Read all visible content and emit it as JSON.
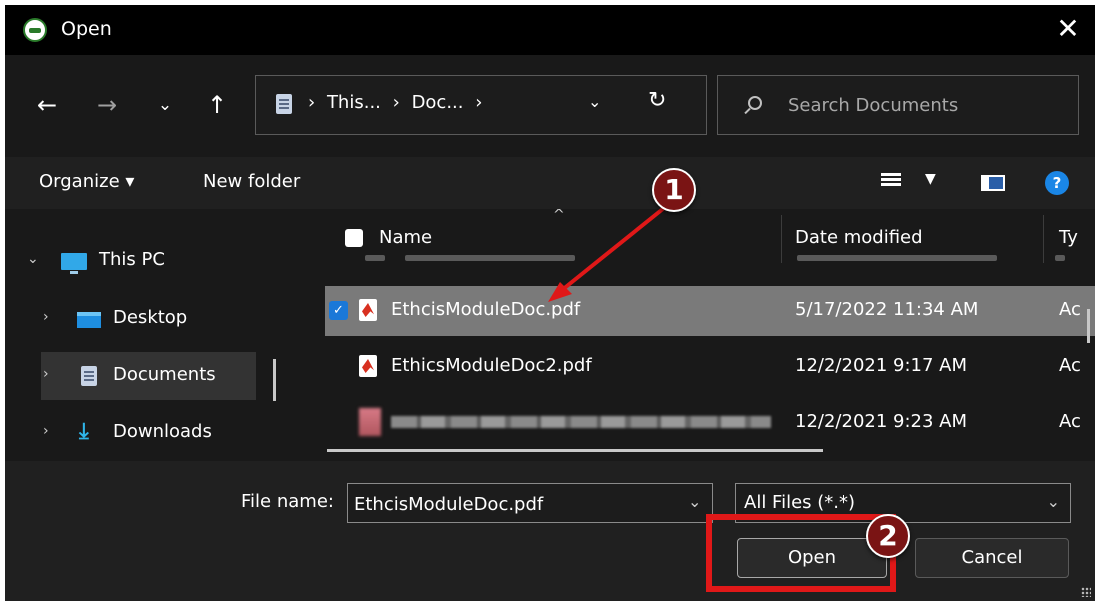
{
  "window": {
    "title": "Open"
  },
  "nav": {
    "back": "←",
    "forward": "→",
    "recent": "⌄",
    "up": "↑",
    "breadcrumb": [
      "›",
      "This...",
      "›",
      "Doc...",
      "›"
    ],
    "search_placeholder": "Search Documents"
  },
  "toolbar": {
    "organize": "Organize ▾",
    "new_folder": "New folder",
    "help": "?"
  },
  "navpane": {
    "items": [
      {
        "label": "This PC",
        "chevron": "⌄"
      },
      {
        "label": "Desktop",
        "chevron": "›"
      },
      {
        "label": "Documents",
        "chevron": "›"
      },
      {
        "label": "Downloads",
        "chevron": "›"
      }
    ]
  },
  "filelist": {
    "columns": {
      "name": "Name",
      "date": "Date modified",
      "type": "Ty"
    },
    "rows": [
      {
        "name": "EthcisModuleDoc.pdf",
        "date": "5/17/2022 11:34 AM",
        "type": "Ac",
        "selected": true
      },
      {
        "name": "EthicsModuleDoc2.pdf",
        "date": "12/2/2021 9:17 AM",
        "type": "Ac",
        "selected": false
      },
      {
        "name": "",
        "date": "12/2/2021 9:23 AM",
        "type": "Ac",
        "selected": false
      }
    ]
  },
  "bottom": {
    "file_name_label": "File name:",
    "file_name_value": "EthcisModuleDoc.pdf",
    "file_type_value": "All Files (*.*)",
    "open_label": "Open",
    "cancel_label": "Cancel"
  },
  "annotations": {
    "callout_1": "1",
    "callout_2": "2"
  },
  "colors": {
    "accent": "#1a78d8",
    "annotation_red": "#e01818",
    "callout_fill": "#7a1414"
  }
}
